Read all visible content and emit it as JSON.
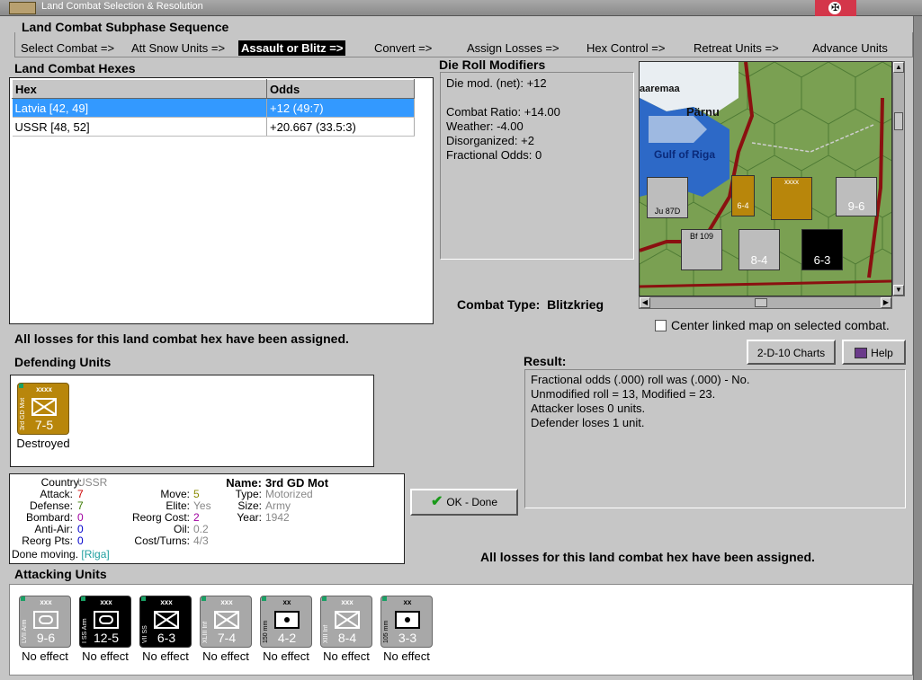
{
  "window": {
    "title": "Land Combat Selection & Resolution"
  },
  "sequence": {
    "title": "Land Combat Subphase Sequence",
    "steps": [
      "Select Combat =>",
      "Att Snow Units =>",
      "Assault or Blitz =>",
      "Convert =>",
      "Assign Losses =>",
      "Hex Control =>",
      "Retreat Units =>",
      "Advance Units"
    ],
    "active_index": 2
  },
  "hexes": {
    "title": "Land Combat Hexes",
    "columns": [
      "Hex",
      "Odds"
    ],
    "rows": [
      {
        "hex": "Latvia [42, 49]",
        "odds": "+12 (49:7)"
      },
      {
        "hex": "USSR [48, 52]",
        "odds": "+20.667 (33.5:3)"
      }
    ]
  },
  "die": {
    "title": "Die Roll Modifiers",
    "lines": [
      "Die mod. (net): +12",
      "",
      "Combat Ratio: +14.00",
      "Weather: -4.00",
      "Disorganized: +2",
      "Fractional Odds: 0"
    ]
  },
  "map": {
    "places": [
      "aaremaa",
      "Pärnu",
      "Gulf of Riga"
    ],
    "counters": [
      {
        "size": "xxxx",
        "fac": "6-4"
      },
      {
        "size": "xxx",
        "fac": "9-6"
      },
      {
        "size": "xxx",
        "fac": "8-4"
      },
      {
        "size": "xxx",
        "fac": "6-3"
      },
      {
        "size": "",
        "fac": "Ju 87D"
      },
      {
        "size": "",
        "fac": "Bf 109"
      }
    ]
  },
  "combat_type": {
    "label": "Combat Type:",
    "value": "Blitzkrieg"
  },
  "center_map": {
    "label": "Center linked map on selected combat."
  },
  "buttons": {
    "charts": "2-D-10 Charts",
    "help": "Help",
    "ok": "OK - Done"
  },
  "losses_msg": "All losses for this land combat hex have been assigned.",
  "defending": {
    "title": "Defending Units",
    "units": [
      {
        "size": "xxxx",
        "name": "3rd GD Mot",
        "fac": "7-5",
        "status": "Destroyed"
      }
    ]
  },
  "result": {
    "title": "Result:",
    "lines": [
      "Fractional odds (.000) roll was (.000)  - No.",
      "Unmodified roll = 13, Modified = 23.",
      "Attacker loses 0 units.",
      "Defender loses 1 unit."
    ]
  },
  "info": {
    "country_label": "Country:",
    "country": "USSR",
    "attack_label": "Attack:",
    "attack": "7",
    "defense_label": "Defense:",
    "defense": "7",
    "bombard_label": "Bombard:",
    "bombard": "0",
    "antiair_label": "Anti-Air:",
    "antiair": "0",
    "reorgpts_label": "Reorg Pts:",
    "reorgpts": "0",
    "move_label": "Move:",
    "move": "5",
    "elite_label": "Elite:",
    "elite": "Yes",
    "reorgcost_label": "Reorg Cost:",
    "reorgcost": "2",
    "oil_label": "Oil:",
    "oil": "0.2",
    "costturns_label": "Cost/Turns:",
    "costturns": "4/3",
    "name_label": "Name:",
    "name": "3rd GD Mot",
    "type_label": "Type:",
    "type": "Motorized",
    "size_label": "Size:",
    "size": "Army",
    "year_label": "Year:",
    "year": "1942",
    "done_moving": "Done moving.",
    "done_where": "[Riga]"
  },
  "attacking": {
    "title": "Attacking Units",
    "units": [
      {
        "size": "xxx",
        "name": "LVII Arm",
        "fac": "9-6",
        "status": "No effect"
      },
      {
        "size": "xxx",
        "name": "I SS Arm",
        "fac": "12-5",
        "status": "No effect"
      },
      {
        "size": "xxx",
        "name": "VII SS",
        "fac": "6-3",
        "status": "No effect"
      },
      {
        "size": "xxx",
        "name": "XLIII Inf",
        "fac": "7-4",
        "status": "No effect"
      },
      {
        "size": "xx",
        "name": "150 mm",
        "fac": "4-2",
        "status": "No effect"
      },
      {
        "size": "xxx",
        "name": "XIII Inf",
        "fac": "8-4",
        "status": "No effect"
      },
      {
        "size": "xx",
        "name": "105 mm",
        "fac": "3-3",
        "status": "No effect"
      }
    ]
  },
  "colors": {
    "selected_row": "#3399ff",
    "defender_unit": "#b8860b",
    "attacker_unit": "#a8a8a8",
    "attacker_elite": "#000000",
    "red_value": "#cc0000",
    "green_value": "#3a7a00",
    "purple_value": "#a000a0",
    "blue_value": "#0000cc",
    "olive_value": "#8a8a00",
    "grey_value": "#888888",
    "teal_value": "#20a0a0"
  }
}
